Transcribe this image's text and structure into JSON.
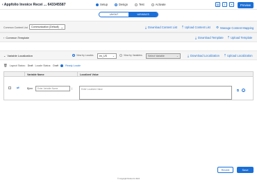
{
  "header": {
    "back_glyph": "‹",
    "title": "Appfolio Invoice Recei ... 643345587",
    "steps": [
      {
        "label": "Setup",
        "state": "done"
      },
      {
        "label": "Design",
        "state": "active"
      },
      {
        "label": "Test",
        "state": "todo"
      },
      {
        "label": "Activate",
        "state": "todo"
      }
    ],
    "icons": [
      "save-copy-icon",
      "export-icon",
      "trash-icon"
    ],
    "preview_label": "Preview"
  },
  "view_toggle": {
    "layout_label": "LAYOUT",
    "variables_label": "VARIABLES",
    "selected": "VARIABLES"
  },
  "content_bar": {
    "common_content_label": "Common Content List",
    "common_content_value": "Communication (Default)",
    "download_content_label": "Download Content List",
    "upload_content_label": "Upload Content List",
    "manage_content_label": "Manage Content Mapping"
  },
  "common_template": {
    "title": "Common Template",
    "download_label": "Download Template",
    "upload_label": "Upload Template"
  },
  "variable_localization": {
    "title": "Variable Localization",
    "view_by_locales_label": "View by Locales",
    "locale_value": "en_US",
    "view_by_variables_label": "View by Variables",
    "select_variable_placeholder": "Select Variable",
    "download_label": "Download Localization",
    "upload_label": "Upload Localization"
  },
  "status": {
    "layout_status_label": "Layout Status:",
    "layout_status_value": "Draft",
    "locale_status_label": "Locale Status:",
    "locale_status_value": "Draft",
    "ready_label": "Ready Locale"
  },
  "table": {
    "columns": [
      "Variable Name",
      "Localized Value"
    ],
    "row": {
      "prefix": "$(em",
      "var_placeholder": "Enter Variable Name",
      "var_suffix": ")",
      "value_placeholder": "Enter Localized Value"
    }
  },
  "footer": {
    "revert_label": "Revert",
    "save_label": "Save",
    "copyright": "© Copyright Notice for 2024"
  },
  "colors": {
    "accent": "#1b6fd6",
    "section_bg": "#f5f5f5"
  }
}
